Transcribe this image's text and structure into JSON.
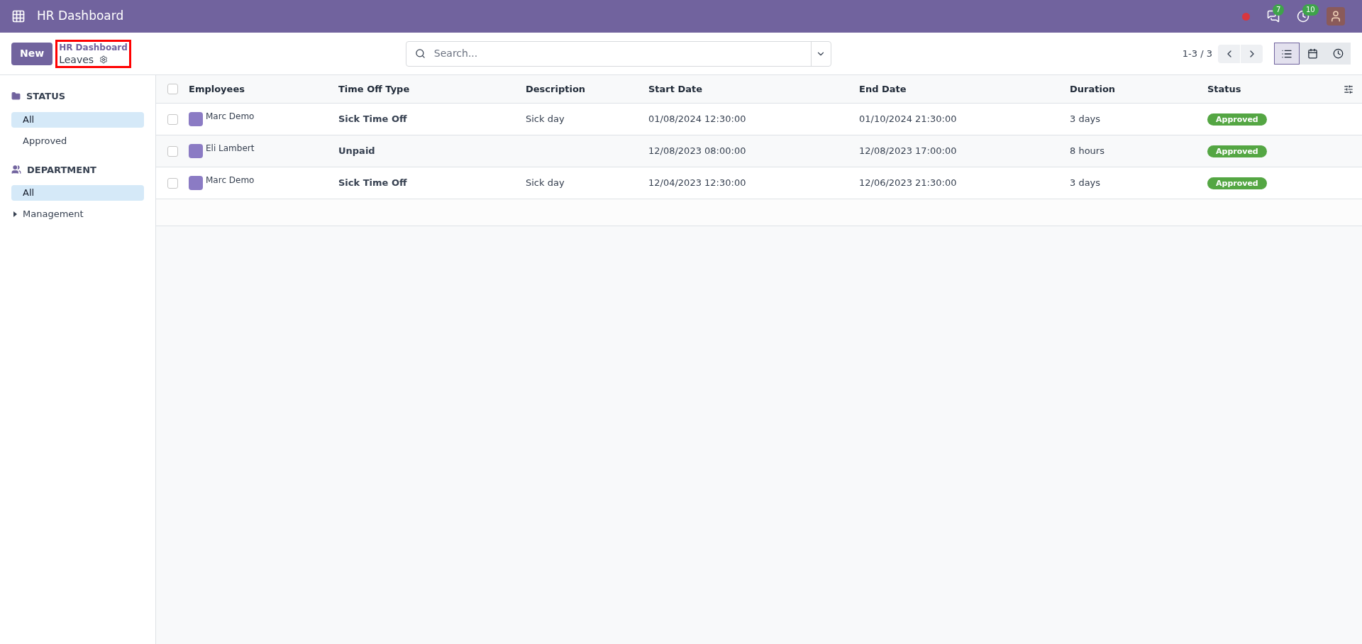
{
  "navbar": {
    "title": "HR Dashboard",
    "messages_count": "7",
    "activities_count": "10"
  },
  "control_panel": {
    "new_button": "New",
    "breadcrumb": {
      "parent": "HR Dashboard",
      "current": "Leaves"
    },
    "search": {
      "placeholder": "Search..."
    },
    "pager": "1-3 / 3",
    "views": [
      {
        "kind": "list",
        "selected": true
      },
      {
        "kind": "calendar",
        "selected": false
      },
      {
        "kind": "activity",
        "selected": false
      }
    ]
  },
  "sidebar": {
    "sections": [
      {
        "kind": "status",
        "title": "STATUS",
        "items": [
          {
            "label": "All",
            "selected": true,
            "expandable": false
          },
          {
            "label": "Approved",
            "selected": false,
            "expandable": false
          }
        ]
      },
      {
        "kind": "department",
        "title": "DEPARTMENT",
        "items": [
          {
            "label": "All",
            "selected": true,
            "expandable": false
          },
          {
            "label": "Management",
            "selected": false,
            "expandable": true
          }
        ]
      }
    ]
  },
  "table": {
    "select_all_checked": false,
    "columns": [
      "Employees",
      "Time Off Type",
      "Description",
      "Start Date",
      "End Date",
      "Duration",
      "Status"
    ],
    "rows": [
      {
        "checked": false,
        "employee": "Marc Demo",
        "time_off_type": "Sick Time Off",
        "description": "Sick day",
        "start_date": "01/08/2024 12:30:00",
        "end_date": "01/10/2024 21:30:00",
        "duration": "3 days",
        "status": "Approved"
      },
      {
        "checked": false,
        "employee": "Eli Lambert",
        "time_off_type": "Unpaid",
        "start_date": "12/08/2023 08:00:00",
        "end_date": "12/08/2023 17:00:00",
        "duration": "8 hours",
        "status": "Approved"
      },
      {
        "checked": false,
        "employee": "Marc Demo",
        "time_off_type": "Sick Time Off",
        "description": "Sick day",
        "start_date": "12/04/2023 12:30:00",
        "end_date": "12/06/2023 21:30:00",
        "duration": "3 days",
        "status": "Approved"
      }
    ]
  }
}
